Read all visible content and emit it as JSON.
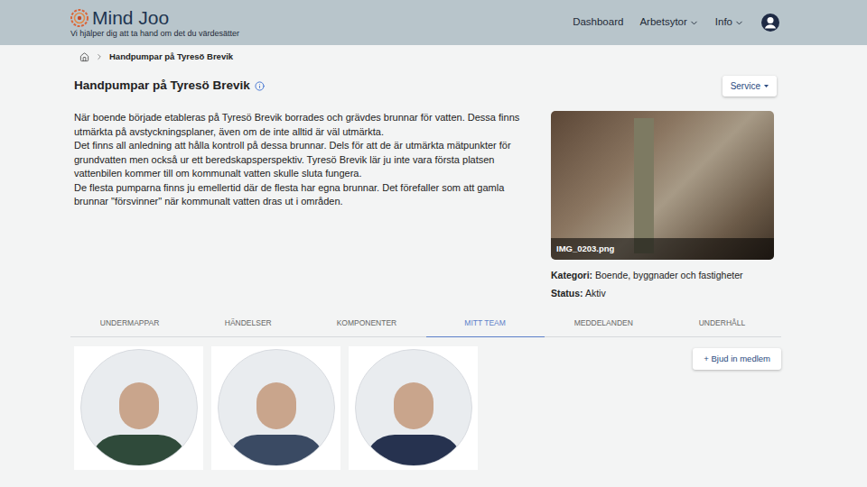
{
  "header": {
    "logo": "Mind Joo",
    "tagline": "Vi hjälper dig att ta hand om det du värdesätter",
    "nav": [
      {
        "label": "Dashboard",
        "dropdown": false
      },
      {
        "label": "Arbetsytor",
        "dropdown": true
      },
      {
        "label": "Info",
        "dropdown": true
      }
    ]
  },
  "breadcrumb": {
    "current": "Handpumpar på Tyresö Brevik"
  },
  "page": {
    "title": "Handpumpar på Tyresö Brevik",
    "service_button": "Service",
    "description": [
      "När boende började etableras på Tyresö Brevik borrades och grävdes brunnar för vatten. Dessa finns utmärkta på avstyckningsplaner, även om de inte alltid är väl utmärkta.",
      "Det finns all anledning att hålla kontroll på dessa brunnar. Dels för att de är utmärkta mätpunkter för grundvatten men också ur ett beredskapsperspektiv. Tyresö Brevik lär ju inte vara första platsen vattenbilen kommer till om kommunalt vatten skulle sluta fungera.",
      "De flesta pumparna finns ju emellertid där de flesta har egna brunnar. Det förefaller som att gamla brunnar \"försvinner\" när kommunalt vatten dras ut i områden."
    ],
    "image": {
      "caption": "IMG_0203.png"
    },
    "meta": [
      {
        "label": "Kategori:",
        "value": "Boende, byggnader och fastigheter"
      },
      {
        "label": "Status:",
        "value": "Aktiv"
      }
    ]
  },
  "tabs": [
    {
      "label": "UNDERMAPPAR",
      "selected": false
    },
    {
      "label": "HÄNDELSER",
      "selected": false
    },
    {
      "label": "KOMPONENTER",
      "selected": false
    },
    {
      "label": "MITT TEAM",
      "selected": true
    },
    {
      "label": "MEDDELANDEN",
      "selected": false
    },
    {
      "label": "UNDERHÅLL",
      "selected": false
    }
  ],
  "team": {
    "invite_button": "+ Bjud in medlem",
    "members": [
      {
        "color": "#2f4a3a"
      },
      {
        "color": "#3a4a63"
      },
      {
        "color": "#26324f"
      }
    ]
  }
}
